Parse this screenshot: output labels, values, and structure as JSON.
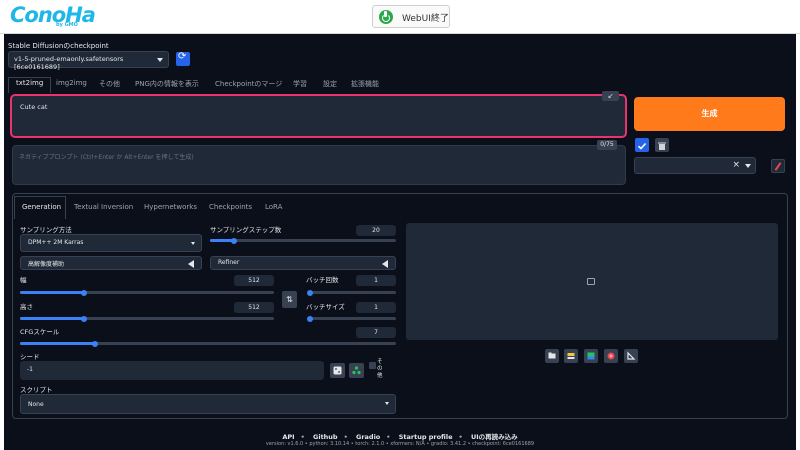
{
  "brand": {
    "logo": "ConoHa",
    "sub": "by GMO"
  },
  "topbar": {
    "end_button": "WebUI終了"
  },
  "checkpoint": {
    "label": "Stable Diffusionのcheckpoint",
    "value": "v1-5-pruned-emaonly.safetensors [6ce0161689]"
  },
  "main_tabs": [
    "txt2img",
    "img2img",
    "その他",
    "PNG内の情報を表示",
    "Checkpointのマージ",
    "学習",
    "設定",
    "拡張機能"
  ],
  "prompt": {
    "value": "Cute cat",
    "mini_button": "↙"
  },
  "negative_prompt": {
    "placeholder": "ネガティブプロンプト (Ctrl+Enter か Alt+Enter を押して生成)",
    "counter": "0/75"
  },
  "generate": {
    "label": "生成"
  },
  "sub_tabs": [
    "Generation",
    "Textual Inversion",
    "Hypernetworks",
    "Checkpoints",
    "LoRA"
  ],
  "generation": {
    "sampler_label": "サンプリング方法",
    "sampler_value": "DPM++ 2M Karras",
    "steps_label": "サンプリングステップ数",
    "steps_value": "20",
    "hires_label": "高解像度補助",
    "refiner_label": "Refiner",
    "width_label": "幅",
    "width_value": "512",
    "height_label": "高さ",
    "height_value": "512",
    "batch_count_label": "バッチ回数",
    "batch_count_value": "1",
    "batch_size_label": "バッチサイズ",
    "batch_size_value": "1",
    "cfg_label": "CFGスケール",
    "cfg_value": "7",
    "seed_label": "シード",
    "seed_value": "-1",
    "extra_label": "その他",
    "script_label": "スクリプト",
    "script_value": "None",
    "sliders": {
      "steps": 0.13,
      "width": 0.25,
      "height": 0.25,
      "batch_count": 0.0,
      "batch_size": 0.0,
      "cfg": 0.2
    }
  },
  "footer": {
    "links": [
      "API",
      "Github",
      "Gradio",
      "Startup profile",
      "UIの再読み込み"
    ],
    "version": "version: v1.6.0  •  python: 3.10.14  •  torch: 2.1.0  •  xformers: N/A  •  gradio: 3.41.2  •  checkpoint: 6ce0161689"
  },
  "colors": {
    "accent": "#ff7a1a",
    "prompt_border": "#e8336d",
    "slider": "#3b82f6",
    "bg": "#0b0f19"
  }
}
